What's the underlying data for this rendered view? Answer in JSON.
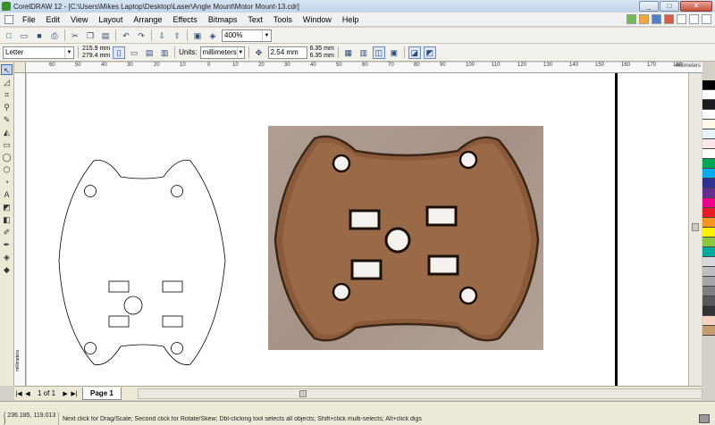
{
  "window": {
    "title": "CorelDRAW 12 - [C:\\Users\\Mikes Laptop\\Desktop\\Laser\\Angle Mount\\Motor Mount-13.cdr]",
    "minimize": "_",
    "maximize": "□",
    "close": "✕"
  },
  "menu": [
    "File",
    "Edit",
    "View",
    "Layout",
    "Arrange",
    "Effects",
    "Bitmaps",
    "Text",
    "Tools",
    "Window",
    "Help"
  ],
  "standard_toolbar": {
    "zoom_level": "400%"
  },
  "property_bar": {
    "paper_size": "Letter",
    "width": "215.9 mm",
    "height": "279.4 mm",
    "units_label": "Units:",
    "units_value": "millimeters",
    "nudge": "2.54 mm",
    "duplicate_x": "6.35 mm",
    "duplicate_y": "6.35 mm"
  },
  "ruler": {
    "h_ticks": [
      "60",
      "50",
      "40",
      "30",
      "20",
      "10",
      "0",
      "10",
      "20",
      "30",
      "40",
      "50",
      "60",
      "70",
      "80",
      "90",
      "100",
      "110",
      "120",
      "130",
      "140",
      "150",
      "160",
      "170",
      "180"
    ],
    "units": "millimeters",
    "v_units": "millimeters"
  },
  "page_nav": {
    "first": "|◀",
    "prev": "◀",
    "count": "1 of 1",
    "next": "▶",
    "last": "▶|",
    "tab_label": "Page 1"
  },
  "status": {
    "coordinates": "( 236.185, 119.013 )",
    "hint": "Next click for Drag/Scale; Second click for Rotate/Skew; Dbl-clicking tool selects all objects; Shift+click multi-selects; Alt+click digs"
  },
  "palette": [
    "#000000",
    "#ffffff",
    "#1c1c1c",
    "#ffffff",
    "#fffbe6",
    "#e6f2ff",
    "#ffe6e6",
    "#ffffff",
    "#00a651",
    "#00aeef",
    "#2e3192",
    "#662d91",
    "#ec008c",
    "#ed1c24",
    "#f7941d",
    "#fff200",
    "#8dc63f",
    "#00a99d",
    "#d9d9d9",
    "#bfbfbf",
    "#a6a6a6",
    "#808080",
    "#595959",
    "#333333",
    "#f6d2c1",
    "#c69c6d"
  ]
}
